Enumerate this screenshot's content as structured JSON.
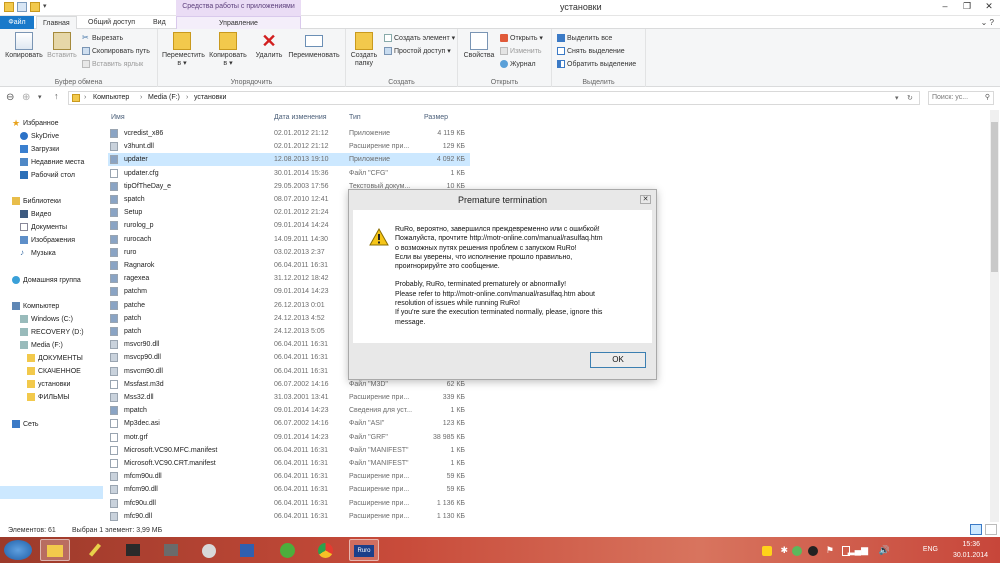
{
  "window": {
    "title": "установки",
    "context_tab": "Средства работы с приложениями"
  },
  "window_controls": [
    "–",
    "❐",
    "✕"
  ],
  "tabs": {
    "file": "Файл",
    "home": "Главная",
    "share": "Общий доступ",
    "view": "Вид",
    "manage": "Управление"
  },
  "ribbon": {
    "clipboard": {
      "label": "Буфер обмена",
      "copy": "Копировать",
      "paste": "Вставить",
      "cut": "Вырезать",
      "copy_path": "Скопировать путь",
      "paste_shortcut": "Вставить ярлык"
    },
    "organize": {
      "label": "Упорядочить",
      "move_to": "Переместить",
      "copy_to": "Копировать",
      "delete": "Удалить",
      "rename": "Переименовать",
      "suffix": "в ▾"
    },
    "new": {
      "label": "Создать",
      "new_folder": "Создать",
      "new_folder2": "папку",
      "new_item": "Создать элемент ▾",
      "easy_access": "Простой доступ ▾"
    },
    "open": {
      "label": "Открыть",
      "properties": "Свойства",
      "open": "Открыть ▾",
      "edit": "Изменить",
      "history": "Журнал"
    },
    "select": {
      "label": "Выделить",
      "select_all": "Выделить все",
      "select_none": "Снять выделение",
      "invert": "Обратить выделение"
    }
  },
  "address": {
    "parts": [
      "Компьютер",
      "Media (F:)",
      "установки"
    ],
    "search_placeholder": "Поиск: ус..."
  },
  "nav": {
    "favorites": "Избранное",
    "skydrive": "SkyDrive",
    "downloads": "Загрузки",
    "recent": "Недавние места",
    "desktop": "Рабочий стол",
    "libraries": "Библиотеки",
    "video": "Видео",
    "documents": "Документы",
    "pictures": "Изображения",
    "music": "Музыка",
    "homegroup": "Домашняя группа",
    "computer": "Компьютер",
    "windows_c": "Windows (C:)",
    "recovery_d": "RECOVERY (D:)",
    "media_f": "Media (F:)",
    "f1": "ДОКУМЕНТЫ",
    "f2": "СКАЧЕННОЕ",
    "f3": "установки",
    "f4": "ФИЛЬМЫ",
    "network": "Сеть"
  },
  "columns": {
    "name": "Имя",
    "date": "Дата изменения",
    "type": "Тип",
    "size": "Размер"
  },
  "files": [
    {
      "name": "vcredist_x86",
      "date": "02.01.2012 21:12",
      "type": "Приложение",
      "size": "4 119 КБ"
    },
    {
      "name": "v3hunt.dll",
      "date": "02.01.2012 21:12",
      "type": "Расширение при...",
      "size": "129 КБ"
    },
    {
      "name": "updater",
      "date": "12.08.2013 19:10",
      "type": "Приложение",
      "size": "4 092 КБ"
    },
    {
      "name": "updater.cfg",
      "date": "30.01.2014 15:36",
      "type": "Файл \"CFG\"",
      "size": "1 КБ"
    },
    {
      "name": "tipOfTheDay_e",
      "date": "29.05.2003 17:56",
      "type": "Текстовый докум...",
      "size": "10 КБ"
    },
    {
      "name": "spatch",
      "date": "08.07.2010 12:41",
      "type": "",
      "size": ""
    },
    {
      "name": "Setup",
      "date": "02.01.2012 21:24",
      "type": "",
      "size": ""
    },
    {
      "name": "rurolog_p",
      "date": "09.01.2014 14:24",
      "type": "",
      "size": ""
    },
    {
      "name": "rurocach",
      "date": "14.09.2011 14:30",
      "type": "",
      "size": ""
    },
    {
      "name": "ruro",
      "date": "03.02.2013 2:37",
      "type": "",
      "size": ""
    },
    {
      "name": "Ragnarok",
      "date": "06.04.2011 16:31",
      "type": "",
      "size": ""
    },
    {
      "name": "ragexea",
      "date": "31.12.2012 18:42",
      "type": "",
      "size": ""
    },
    {
      "name": "patchm",
      "date": "09.01.2014 14:23",
      "type": "",
      "size": ""
    },
    {
      "name": "patche",
      "date": "26.12.2013 0:01",
      "type": "",
      "size": ""
    },
    {
      "name": "patch",
      "date": "24.12.2013 4:52",
      "type": "",
      "size": ""
    },
    {
      "name": "patch",
      "date": "24.12.2013 5:05",
      "type": "",
      "size": ""
    },
    {
      "name": "msvcr90.dll",
      "date": "06.04.2011 16:31",
      "type": "",
      "size": ""
    },
    {
      "name": "msvcp90.dll",
      "date": "06.04.2011 16:31",
      "type": "",
      "size": ""
    },
    {
      "name": "msvcm90.dll",
      "date": "06.04.2011 16:31",
      "type": "",
      "size": ""
    },
    {
      "name": "Mssfast.m3d",
      "date": "06.07.2002 14:16",
      "type": "Файл \"M3D\"",
      "size": "62 КБ"
    },
    {
      "name": "Mss32.dll",
      "date": "31.03.2001 13:41",
      "type": "Расширение при...",
      "size": "339 КБ"
    },
    {
      "name": "mpatch",
      "date": "09.01.2014 14:23",
      "type": "Сведения для уст...",
      "size": "1 КБ"
    },
    {
      "name": "Mp3dec.asi",
      "date": "06.07.2002 14:16",
      "type": "Файл \"ASI\"",
      "size": "123 КБ"
    },
    {
      "name": "motr.grf",
      "date": "09.01.2014 14:23",
      "type": "Файл \"GRF\"",
      "size": "38 985 КБ"
    },
    {
      "name": "Microsoft.VC90.MFC.manifest",
      "date": "06.04.2011 16:31",
      "type": "Файл \"MANIFEST\"",
      "size": "1 КБ"
    },
    {
      "name": "Microsoft.VC90.CRT.manifest",
      "date": "06.04.2011 16:31",
      "type": "Файл \"MANIFEST\"",
      "size": "1 КБ"
    },
    {
      "name": "mfcm90u.dll",
      "date": "06.04.2011 16:31",
      "type": "Расширение при...",
      "size": "59 КБ"
    },
    {
      "name": "mfcm90.dll",
      "date": "06.04.2011 16:31",
      "type": "Расширение при...",
      "size": "59 КБ"
    },
    {
      "name": "mfc90u.dll",
      "date": "06.04.2011 16:31",
      "type": "Расширение при...",
      "size": "1 136 КБ"
    },
    {
      "name": "mfc90.dll",
      "date": "06.04.2011 16:31",
      "type": "Расширение при...",
      "size": "1 130 КБ"
    }
  ],
  "dialog": {
    "title": "Premature termination",
    "close": "✕",
    "ru": "RuRo, вероятно, завершился преждевременно или с ошибкой!\nПожалуйста, прочтите http://motr-online.com/manual/rasulfaq.htm\nо возможных путях решения проблем с запуском RuRo!\nЕсли вы уверены, что исполнение прошло правильно,\nпроигнорируйте это сообщение.",
    "en": "Probably, RuRo, terminated prematurely or abnormally!\nPlease refer to http://motr-online.com/manual/rasulfaq.htm about\nresolution of issues while running RuRo!\nIf you're sure the execution terminated normally, please, ignore this\nmessage.",
    "ok": "OK"
  },
  "status": {
    "count": "Элементов: 61",
    "selected": "Выбран 1 элемент: 3,99 МБ"
  },
  "taskbar": {
    "ruro_label": "Ruro"
  },
  "tray": {
    "lang": "ENG",
    "time": "15:36",
    "date": "30.01.2014"
  }
}
